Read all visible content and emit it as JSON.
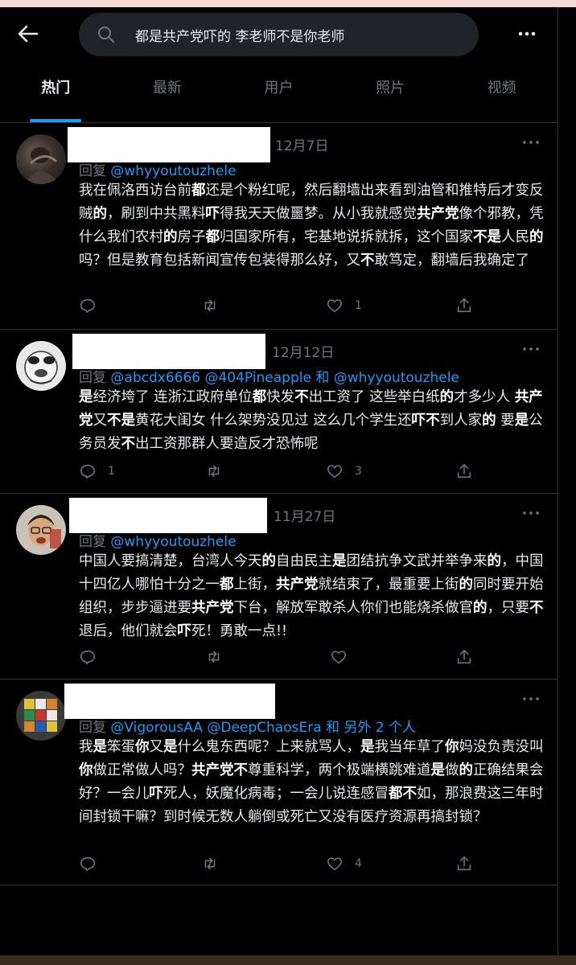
{
  "search": {
    "query": "都是共产党吓的 李老师不是你老师"
  },
  "tabs": [
    "热门",
    "最新",
    "用户",
    "照片",
    "视频"
  ],
  "tweets": [
    {
      "date": "12月7日",
      "reply_prefix": "回复",
      "mentions": "@whyyoutouzhele",
      "body": [
        "我在佩洛西访台前",
        {
          "b": "都"
        },
        "还是个粉红呢，然后翻墙出来看到油管和推特后才变反贼",
        {
          "b": "的"
        },
        "，刷到中共黑料",
        {
          "b": "吓"
        },
        "得我天天做噩梦。从小我就感觉",
        {
          "b": "共产党"
        },
        "像个邪教，凭什么我们农村",
        {
          "b": "的"
        },
        "房子",
        {
          "b": "都"
        },
        "归国家所有，宅基地说拆就拆，这个国家",
        {
          "b": "不是"
        },
        "人民",
        {
          "b": "的"
        },
        "吗？但是教育包括新闻宣传包装得那么好，又",
        {
          "b": "不"
        },
        "敢笃定，翻墙后我确定了"
      ],
      "counts": {
        "reply": "",
        "retweet": "",
        "like": "1"
      }
    },
    {
      "date": "12月12日",
      "reply_prefix": "回复",
      "mentions": "@abcdx6666 @404Pineapple 和 @whyyoutouzhele",
      "body": [
        {
          "b": "是"
        },
        "经济垮了 连浙江政府单位",
        {
          "b": "都"
        },
        "快发",
        {
          "b": "不"
        },
        "出工资了 这些举白纸",
        {
          "b": "的"
        },
        "才多少人 ",
        {
          "b": "共产党"
        },
        "又",
        {
          "b": "不是"
        },
        "黄花大闺女 什么架势没见过 这么几个学生还",
        {
          "b": "吓不"
        },
        "到人家",
        {
          "b": "的"
        },
        " 要",
        {
          "b": "是"
        },
        "公务员发",
        {
          "b": "不"
        },
        "出工资那群人要造反才恐怖呢"
      ],
      "counts": {
        "reply": "1",
        "retweet": "",
        "like": "3"
      }
    },
    {
      "date": "11月27日",
      "reply_prefix": "回复",
      "mentions": "@whyyoutouzhele",
      "body": [
        "中国人要搞清楚，台湾人今天",
        {
          "b": "的"
        },
        "自由民主",
        {
          "b": "是"
        },
        "团结抗争文武并举争来",
        {
          "b": "的"
        },
        "，中国十四亿人哪怕十分之一",
        {
          "b": "都"
        },
        "上街，",
        {
          "b": "共产党"
        },
        "就结束了，最重要上街",
        {
          "b": "的"
        },
        "同时要开始组织，步步逼进要",
        {
          "b": "共产党"
        },
        "下台，解放军敢杀人你们也能烧杀做官",
        {
          "b": "的"
        },
        "，只要",
        {
          "b": "不"
        },
        "退后，他们就会",
        {
          "b": "吓"
        },
        "死！勇敢一点!!"
      ],
      "counts": {
        "reply": "",
        "retweet": "",
        "like": ""
      }
    },
    {
      "date": "",
      "reply_prefix": "回复",
      "mentions": "@VigorousAA @DeepChaosEra 和 另外 2 个人",
      "body": [
        "我",
        {
          "b": "是"
        },
        "笨蛋",
        {
          "b": "你"
        },
        "又",
        {
          "b": "是"
        },
        "什么鬼东西呢？上来就骂人，",
        {
          "b": "是"
        },
        "我当年草了",
        {
          "b": "你"
        },
        "妈没负责没叫",
        {
          "b": "你"
        },
        "做正常做人吗？",
        {
          "b": "共产党不"
        },
        "尊重科学，两个极端横跳难道",
        {
          "b": "是"
        },
        "做",
        {
          "b": "的"
        },
        "正确结果会好？一会儿",
        {
          "b": "吓"
        },
        "死人，妖魔化病毒；一会儿说连感冒",
        {
          "b": "都不"
        },
        "如，那浪费这三年时间封锁干嘛？到时候无数人躺倒或死亡又没有医疗资源再搞封锁？"
      ],
      "counts": {
        "reply": "",
        "retweet": "",
        "like": "4"
      }
    }
  ],
  "icons": {
    "back": "arrow-left-icon",
    "search": "search-icon",
    "more": "more-horizontal-icon",
    "reply": "reply-bubble-icon",
    "retweet": "retweet-icon",
    "like": "heart-icon",
    "share": "share-icon"
  },
  "colors": {
    "accent": "#1d9bf0",
    "muted": "#71767b",
    "background": "#000000",
    "search_bg": "#202327"
  }
}
